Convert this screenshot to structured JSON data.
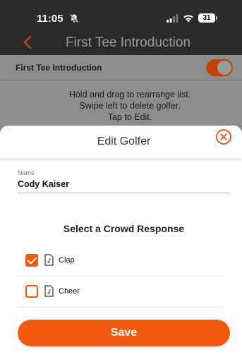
{
  "status_bar": {
    "time": "11:05",
    "battery": "31"
  },
  "nav": {
    "title": "First Tee Introduction"
  },
  "background": {
    "toggle_label": "First Tee Introduction",
    "instructions": [
      "Hold and drag to rearrange list.",
      "Swipe left to delete golfer.",
      "Tap to Edit."
    ]
  },
  "sheet": {
    "title": "Edit Golfer",
    "name_label": "Name",
    "name_value": "Cody Kaiser",
    "crowd_heading": "Select a Crowd Response",
    "responses": [
      {
        "label": "Clap",
        "checked": true
      },
      {
        "label": "Cheer",
        "checked": false
      }
    ],
    "save_label": "Save"
  },
  "colors": {
    "accent": "#f25a12",
    "nav_bg": "#2b2b2b",
    "dim_bg": "#8d8d8d"
  },
  "icons": [
    "bell-slash-icon",
    "signal-icon",
    "wifi-icon",
    "battery-icon",
    "back-chevron-icon",
    "close-circle-icon",
    "sound-file-icon",
    "checkbox-icon"
  ]
}
